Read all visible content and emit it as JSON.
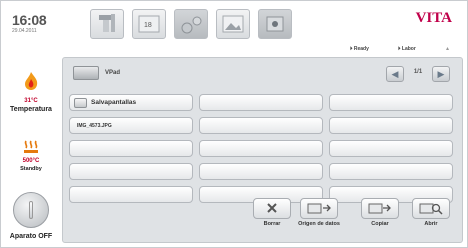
{
  "header": {
    "time": "16:08",
    "date": "29.04.2011",
    "brand": "VITA",
    "brand_color": "#c0004a",
    "status_ready": "⏵ Ready",
    "status_labor": "⏵ Labor",
    "tabs": [
      {
        "name": "tab-press",
        "icon": "press-icon"
      },
      {
        "name": "tab-program",
        "icon": "program-icon"
      },
      {
        "name": "tab-settings",
        "icon": "settings-icon"
      },
      {
        "name": "tab-images",
        "icon": "images-icon"
      },
      {
        "name": "tab-vpad",
        "icon": "vpad-icon",
        "active": true
      }
    ]
  },
  "left": {
    "temperature_value": "31°C",
    "temperature_label": "Temperatura",
    "standby_value": "500°C",
    "standby_label": "Standby",
    "power_label": "Aparato OFF"
  },
  "browser": {
    "path": "VPad",
    "pager": "1/1",
    "items": [
      {
        "label": "Salvapantallas",
        "type": "folder"
      },
      {
        "label": "",
        "type": "empty"
      },
      {
        "label": "",
        "type": "empty"
      },
      {
        "label": "IMG_4573.JPG",
        "type": "file"
      },
      {
        "label": "",
        "type": "empty"
      },
      {
        "label": "",
        "type": "empty"
      },
      {
        "label": "",
        "type": "empty"
      },
      {
        "label": "",
        "type": "empty"
      },
      {
        "label": "",
        "type": "empty"
      },
      {
        "label": "",
        "type": "empty"
      },
      {
        "label": "",
        "type": "empty"
      },
      {
        "label": "",
        "type": "empty"
      },
      {
        "label": "",
        "type": "empty"
      },
      {
        "label": "",
        "type": "empty"
      },
      {
        "label": "",
        "type": "empty"
      }
    ]
  },
  "actions": {
    "delete": "Borrar",
    "source": "Origen de datos",
    "copy": "Copiar",
    "open": "Abrir"
  }
}
